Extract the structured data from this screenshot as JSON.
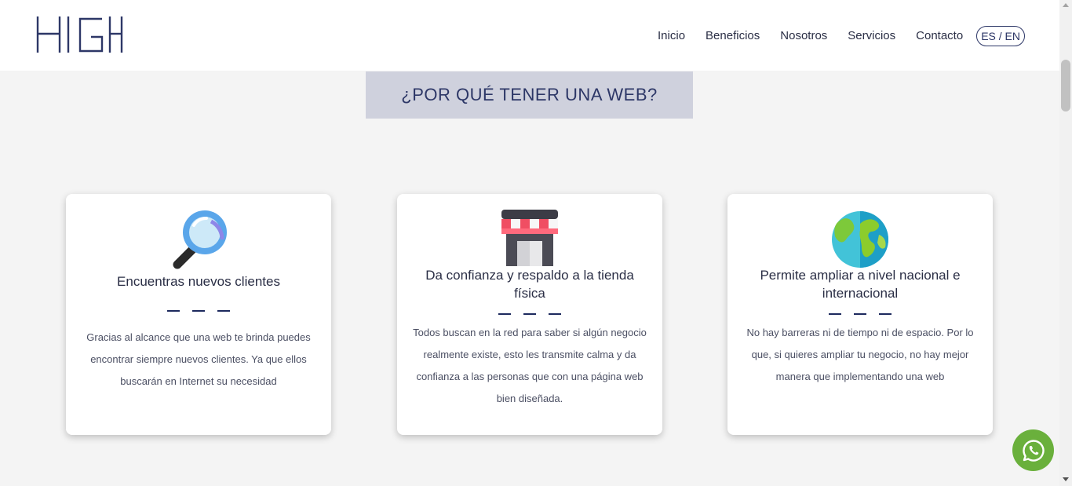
{
  "header": {
    "logo_text": "HIGH",
    "nav": [
      "Inicio",
      "Beneficios",
      "Nosotros",
      "Servicios",
      "Contacto"
    ],
    "lang_label": "ES / EN"
  },
  "section": {
    "title": "¿POR QUÉ TENER UNA WEB?"
  },
  "cards": [
    {
      "icon": "magnifying-glass-icon",
      "title": "Encuentras nuevos clientes",
      "text": "Gracias al alcance que una web te brinda puedes encontrar siempre nuevos clientes. Ya que ellos buscarán en Internet su necesidad"
    },
    {
      "icon": "storefront-icon",
      "title": "Da confianza y respaldo a la tienda física",
      "text": "Todos buscan en la red para saber si algún negocio realmente existe, esto les transmite calma y da confianza a las personas que con una página web bien diseñada."
    },
    {
      "icon": "globe-icon",
      "title": "Permite ampliar a nivel nacional e internacional",
      "text": "No hay barreras ni de tiempo ni de espacio. Por lo que, si quieres ampliar tu negocio, no hay mejor manera que implementando una web"
    }
  ],
  "colors": {
    "brand_navy": "#2d3767",
    "title_band": "#cfd1dd",
    "whatsapp_green": "#6ab03c"
  }
}
